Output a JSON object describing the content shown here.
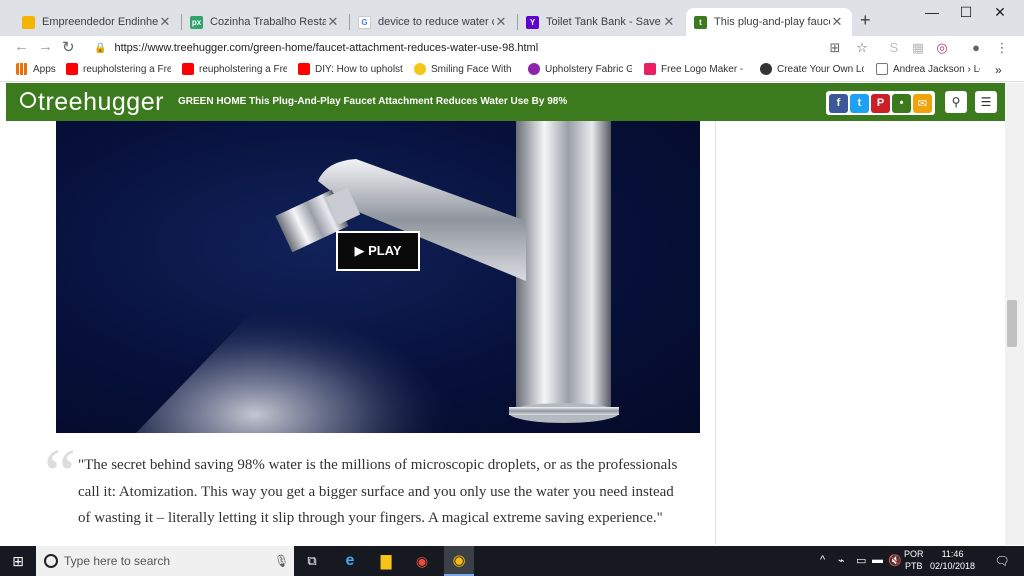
{
  "browser": {
    "tabs": [
      {
        "title": "Empreendedor Endinheirado",
        "favicon_color": "#f4b400",
        "favicon_glyph": ""
      },
      {
        "title": "Cozinha Trabalho Restaurante",
        "favicon_color": "#30a46c",
        "favicon_glyph": "px"
      },
      {
        "title": "device to reduce water consum",
        "favicon_color": "#ffffff",
        "favicon_glyph": "G"
      },
      {
        "title": "Toilet Tank Bank - Save Water",
        "favicon_color": "#5f01d1",
        "favicon_glyph": "Y"
      },
      {
        "title": "This plug-and-play faucet atta",
        "favicon_color": "#3c7a1e",
        "favicon_glyph": "t"
      }
    ],
    "active_tab_index": 4,
    "url": "https://www.treehugger.com/green-home/faucet-attachment-reduces-water-use-98.html",
    "bookmarks": [
      {
        "label": "Apps",
        "icon": "apps-grid-icon"
      },
      {
        "label": "reupholstering a Fre",
        "icon": "youtube-icon"
      },
      {
        "label": "reupholstering a Fre",
        "icon": "youtube-icon"
      },
      {
        "label": "DIY: How to upholste",
        "icon": "youtube-icon"
      },
      {
        "label": "Smiling Face With",
        "icon": "emoji-icon"
      },
      {
        "label": "Upholstery Fabric Gu",
        "icon": "site-icon"
      },
      {
        "label": "Free Logo Maker - C",
        "icon": "logo-maker-icon"
      },
      {
        "label": "Create Your Own Log",
        "icon": "site-icon"
      },
      {
        "label": "Andrea Jackson › Log",
        "icon": "page-icon"
      }
    ],
    "bookmarks_overflow": "»",
    "extension_badge": "8"
  },
  "site": {
    "logo": "treehugger",
    "section": "GREEN HOME",
    "headline": "This Plug-And-Play Faucet Attachment Reduces Water Use By 98%",
    "header_color": "#3c7a1e",
    "social": [
      {
        "name": "facebook-icon",
        "glyph": "f",
        "color": "#3b5998"
      },
      {
        "name": "twitter-icon",
        "glyph": "t",
        "color": "#1da1f2"
      },
      {
        "name": "pinterest-icon",
        "glyph": "P",
        "color": "#cb2027"
      },
      {
        "name": "comment-icon",
        "glyph": "•",
        "color": "#3c7a1e"
      },
      {
        "name": "email-icon",
        "glyph": "✉",
        "color": "#f0a30a"
      }
    ]
  },
  "video": {
    "play_label": "▶ PLAY"
  },
  "article": {
    "quote": "\"The secret behind saving 98% water is the millions of microscopic droplets, or as the professionals call it: Atomization. This way you get a bigger surface and you only use the water you need instead of wasting it – literally letting it slip through your fingers. A magical extreme saving experience.\""
  },
  "taskbar": {
    "search_placeholder": "Type here to search",
    "lang_line1": "POR",
    "lang_line2": "PTB",
    "time": "11:46",
    "date": "02/10/2018"
  }
}
